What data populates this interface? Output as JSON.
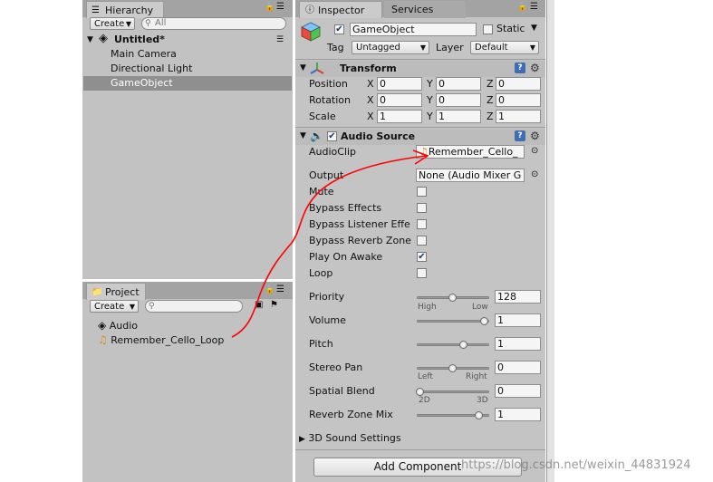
{
  "hierarchy": {
    "tab_label": "Hierarchy",
    "create_label": "Create",
    "search_placeholder": "All",
    "scene_name": "Untitled*",
    "items": [
      "Main Camera",
      "Directional Light",
      "GameObject"
    ]
  },
  "project": {
    "tab_label": "Project",
    "create_label": "Create",
    "items": [
      "Audio",
      "Remember_Cello_Loop"
    ]
  },
  "inspector": {
    "tabs": [
      "Inspector",
      "Services"
    ],
    "object_name": "GameObject",
    "static_label": "Static",
    "tag_label": "Tag",
    "tag_value": "Untagged",
    "layer_label": "Layer",
    "layer_value": "Default",
    "transform": {
      "title": "Transform",
      "rows": [
        {
          "label": "Position",
          "x": "0",
          "y": "0",
          "z": "0"
        },
        {
          "label": "Rotation",
          "x": "0",
          "y": "0",
          "z": "0"
        },
        {
          "label": "Scale",
          "x": "1",
          "y": "1",
          "z": "1"
        }
      ],
      "axis_x": "X",
      "axis_y": "Y",
      "axis_z": "Z"
    },
    "audio_source": {
      "title": "Audio Source",
      "audioclip_label": "AudioClip",
      "audioclip_value": "Remember_Cello_",
      "output_label": "Output",
      "output_value": "None (Audio Mixer G",
      "toggles": [
        {
          "label": "Mute",
          "checked": false
        },
        {
          "label": "Bypass Effects",
          "checked": false
        },
        {
          "label": "Bypass Listener Effe",
          "checked": false
        },
        {
          "label": "Bypass Reverb Zone",
          "checked": false
        },
        {
          "label": "Play On Awake",
          "checked": true
        },
        {
          "label": "Loop",
          "checked": false
        }
      ],
      "sliders": [
        {
          "label": "Priority",
          "value": "128",
          "fraction": 0.5,
          "left": "High",
          "right": "Low"
        },
        {
          "label": "Volume",
          "value": "1",
          "fraction": 1.0,
          "left": "",
          "right": ""
        },
        {
          "label": "Pitch",
          "value": "1",
          "fraction": 0.67,
          "left": "",
          "right": ""
        },
        {
          "label": "Stereo Pan",
          "value": "0",
          "fraction": 0.5,
          "left": "Left",
          "right": "Right"
        },
        {
          "label": "Spatial Blend",
          "value": "0",
          "fraction": 0.0,
          "left": "2D",
          "right": "3D"
        },
        {
          "label": "Reverb Zone Mix",
          "value": "1",
          "fraction": 0.91,
          "left": "",
          "right": ""
        }
      ],
      "sound_settings_label": "3D Sound Settings"
    },
    "add_component_label": "Add Component"
  },
  "watermark": "https://blog.csdn.net/weixin_44831924",
  "colors": {
    "panel": "#c2c2c2",
    "selection": "#8f8f8f",
    "annotation": "#ff0000",
    "help": "#3e6db3"
  }
}
